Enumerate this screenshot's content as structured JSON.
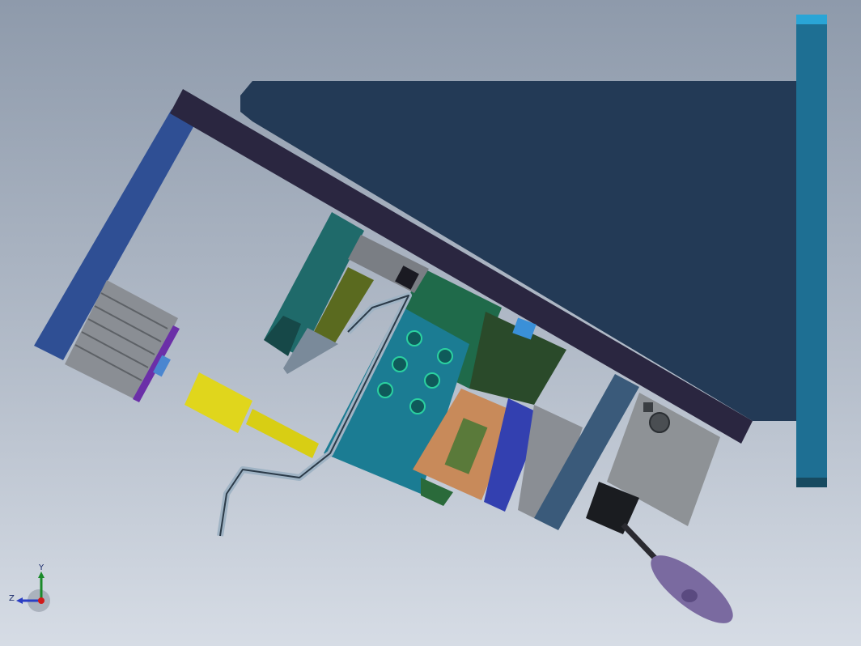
{
  "viewport": {
    "background_top": "#8e9aab",
    "background_bottom": "#d6dce5"
  },
  "model": {
    "parts": [
      "base-plate",
      "side-frame",
      "top-bar",
      "right-column",
      "pneumatic-cylinder",
      "gripper-pins",
      "bent-wire-part",
      "mounting-block",
      "clamp-assembly",
      "motor-unit",
      "handle-knob"
    ],
    "colors": {
      "base_plate": "#233a56",
      "top_bar": "#2a2640",
      "side_frame": "#2f4f94",
      "column": "#1e6f93",
      "mount_block": "#1b7c93",
      "green_block": "#1f6a4a",
      "olive_block": "#5a6a1f",
      "yellow_pin": "#e0d61c",
      "copper_clamp": "#c88a5a",
      "blue_plate": "#3340b0",
      "handle": "#7a6aa0"
    }
  },
  "triad": {
    "x_label": "",
    "y_label": "Y",
    "z_label": "Z"
  }
}
